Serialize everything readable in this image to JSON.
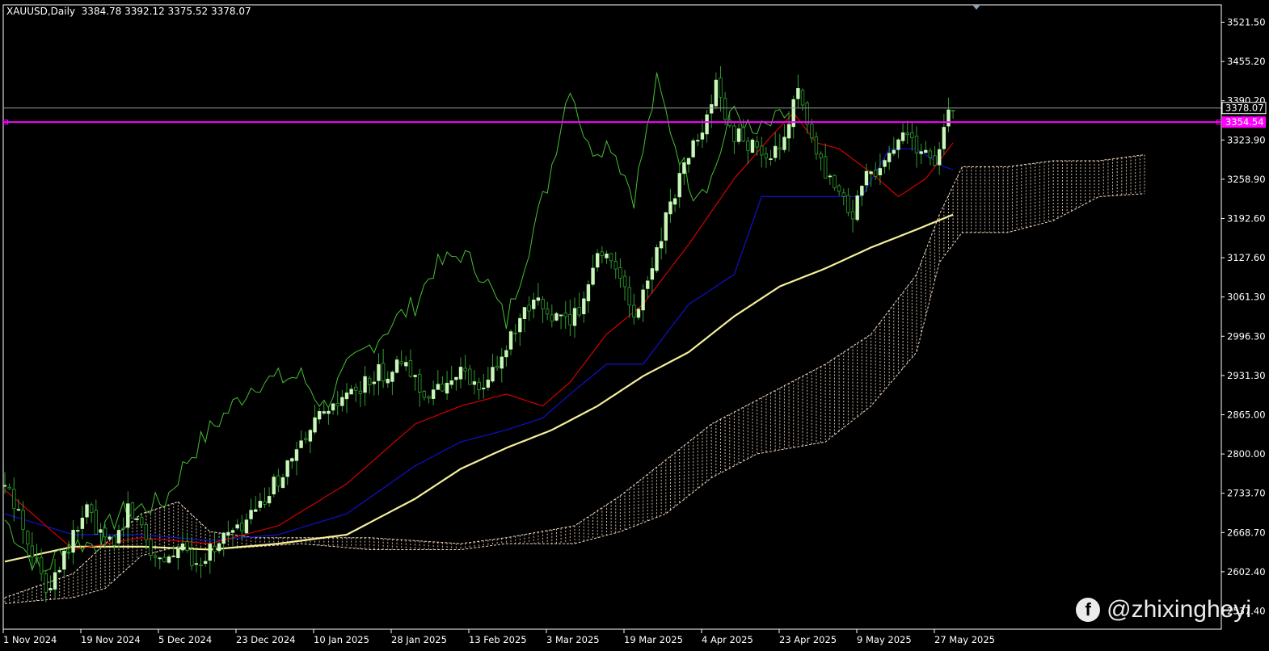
{
  "header": {
    "symbol": "XAUUSD,Daily",
    "ohlc": "3384.78 3392.12 3375.52 3378.07"
  },
  "watermark": {
    "text": "@zhixingheyi",
    "icon": "facebook-icon"
  },
  "colors": {
    "background": "#000000",
    "frame": "#ffffff",
    "candle_up": "#c8f7b8",
    "candle_down": "#000000",
    "candle_wick": "#2e9e2e",
    "chikou": "#44c032",
    "tenkan": "#d40000",
    "kijun": "#1010d0",
    "ma": "#f4ef9a",
    "cloud": "#f3d9c0",
    "hline": "#ff00ff",
    "price_line": "#9a9a9a"
  },
  "chart_data": {
    "type": "candlestick",
    "title": "XAUUSD,Daily",
    "ylim": [
      2540,
      3545
    ],
    "y_ticks": [
      "3521.50",
      "3455.20",
      "3390.20",
      "3323.90",
      "3258.90",
      "3192.60",
      "3127.60",
      "3061.30",
      "2996.30",
      "2931.30",
      "2865.00",
      "2800.00",
      "2733.70",
      "2668.70",
      "2602.40",
      "2537.40"
    ],
    "x_ticks": [
      "1 Nov 2024",
      "19 Nov 2024",
      "5 Dec 2024",
      "23 Dec 2024",
      "10 Jan 2025",
      "28 Jan 2025",
      "13 Feb 2025",
      "3 Mar 2025",
      "19 Mar 2025",
      "4 Apr 2025",
      "23 Apr 2025",
      "9 May 2025",
      "27 May 2025"
    ],
    "current_price": {
      "label": "3378.07",
      "value": 3378.07
    },
    "horizontal_line": {
      "label": "3354.54",
      "value": 3354.54
    },
    "candle_anchors": [
      [
        0,
        2745
      ],
      [
        3,
        2700
      ],
      [
        6,
        2640
      ],
      [
        9,
        2575
      ],
      [
        12,
        2620
      ],
      [
        15,
        2660
      ],
      [
        18,
        2710
      ],
      [
        21,
        2660
      ],
      [
        24,
        2650
      ],
      [
        27,
        2710
      ],
      [
        30,
        2680
      ],
      [
        33,
        2625
      ],
      [
        36,
        2630
      ],
      [
        39,
        2640
      ],
      [
        42,
        2620
      ],
      [
        45,
        2640
      ],
      [
        48,
        2660
      ],
      [
        51,
        2670
      ],
      [
        54,
        2695
      ],
      [
        57,
        2720
      ],
      [
        60,
        2760
      ],
      [
        63,
        2790
      ],
      [
        66,
        2820
      ],
      [
        69,
        2860
      ],
      [
        72,
        2870
      ],
      [
        75,
        2900
      ],
      [
        78,
        2905
      ],
      [
        81,
        2935
      ],
      [
        84,
        2935
      ],
      [
        87,
        2950
      ],
      [
        90,
        2925
      ],
      [
        93,
        2895
      ],
      [
        96,
        2910
      ],
      [
        99,
        2940
      ],
      [
        102,
        2920
      ],
      [
        105,
        2900
      ],
      [
        108,
        2955
      ],
      [
        111,
        2990
      ],
      [
        114,
        3030
      ],
      [
        117,
        3050
      ],
      [
        120,
        3030
      ],
      [
        123,
        3020
      ],
      [
        126,
        3040
      ],
      [
        129,
        3120
      ],
      [
        132,
        3140
      ],
      [
        135,
        3100
      ],
      [
        138,
        3020
      ],
      [
        141,
        3090
      ],
      [
        144,
        3170
      ],
      [
        147,
        3240
      ],
      [
        150,
        3300
      ],
      [
        153,
        3340
      ],
      [
        156,
        3410
      ],
      [
        159,
        3340
      ],
      [
        162,
        3325
      ],
      [
        165,
        3310
      ],
      [
        168,
        3280
      ],
      [
        171,
        3340
      ],
      [
        174,
        3400
      ],
      [
        177,
        3320
      ],
      [
        180,
        3260
      ],
      [
        183,
        3230
      ],
      [
        186,
        3200
      ],
      [
        189,
        3270
      ],
      [
        192,
        3280
      ],
      [
        195,
        3310
      ],
      [
        198,
        3340
      ],
      [
        201,
        3300
      ],
      [
        204,
        3290
      ],
      [
        207,
        3370
      ],
      [
        208,
        3378
      ]
    ],
    "chikou_anchors": [
      [
        0,
        2690
      ],
      [
        8,
        2600
      ],
      [
        14,
        2650
      ],
      [
        20,
        2650
      ],
      [
        25,
        2700
      ],
      [
        30,
        2710
      ],
      [
        35,
        2720
      ],
      [
        40,
        2790
      ],
      [
        45,
        2840
      ],
      [
        50,
        2880
      ],
      [
        55,
        2920
      ],
      [
        60,
        2925
      ],
      [
        65,
        2930
      ],
      [
        70,
        2880
      ],
      [
        75,
        2940
      ],
      [
        80,
        2980
      ],
      [
        85,
        3020
      ],
      [
        90,
        3050
      ],
      [
        94,
        3110
      ],
      [
        100,
        3135
      ],
      [
        105,
        3100
      ],
      [
        110,
        3020
      ],
      [
        115,
        3150
      ],
      [
        119,
        3250
      ],
      [
        124,
        3420
      ],
      [
        128,
        3310
      ],
      [
        133,
        3320
      ],
      [
        138,
        3230
      ],
      [
        143,
        3420
      ],
      [
        147,
        3320
      ],
      [
        151,
        3240
      ],
      [
        155,
        3260
      ],
      [
        160,
        3380
      ],
      [
        164,
        3330
      ],
      [
        168,
        3350
      ],
      [
        172,
        3370
      ]
    ],
    "tenkan_anchors": [
      [
        0,
        2740
      ],
      [
        15,
        2640
      ],
      [
        30,
        2660
      ],
      [
        45,
        2650
      ],
      [
        60,
        2680
      ],
      [
        75,
        2750
      ],
      [
        90,
        2850
      ],
      [
        100,
        2880
      ],
      [
        110,
        2900
      ],
      [
        118,
        2880
      ],
      [
        124,
        2920
      ],
      [
        132,
        3000
      ],
      [
        140,
        3050
      ],
      [
        150,
        3150
      ],
      [
        160,
        3260
      ],
      [
        168,
        3330
      ],
      [
        173,
        3370
      ],
      [
        178,
        3320
      ],
      [
        183,
        3310
      ],
      [
        190,
        3270
      ],
      [
        196,
        3230
      ],
      [
        202,
        3260
      ],
      [
        208,
        3320
      ]
    ],
    "kijun_anchors": [
      [
        0,
        2700
      ],
      [
        15,
        2665
      ],
      [
        30,
        2665
      ],
      [
        45,
        2655
      ],
      [
        60,
        2665
      ],
      [
        75,
        2700
      ],
      [
        90,
        2780
      ],
      [
        100,
        2820
      ],
      [
        110,
        2840
      ],
      [
        118,
        2860
      ],
      [
        124,
        2900
      ],
      [
        132,
        2950
      ],
      [
        140,
        2950
      ],
      [
        150,
        3050
      ],
      [
        160,
        3100
      ],
      [
        166,
        3230
      ],
      [
        175,
        3230
      ],
      [
        188,
        3230
      ],
      [
        194,
        3310
      ],
      [
        200,
        3310
      ],
      [
        206,
        3280
      ],
      [
        208,
        3275
      ]
    ],
    "ma_anchors": [
      [
        0,
        2620
      ],
      [
        15,
        2645
      ],
      [
        30,
        2645
      ],
      [
        45,
        2640
      ],
      [
        60,
        2650
      ],
      [
        75,
        2665
      ],
      [
        90,
        2725
      ],
      [
        100,
        2775
      ],
      [
        110,
        2810
      ],
      [
        120,
        2840
      ],
      [
        130,
        2880
      ],
      [
        140,
        2930
      ],
      [
        150,
        2970
      ],
      [
        160,
        3030
      ],
      [
        170,
        3080
      ],
      [
        180,
        3110
      ],
      [
        190,
        3145
      ],
      [
        200,
        3175
      ],
      [
        208,
        3200
      ]
    ],
    "cloud_a_anchors": [
      [
        0,
        2560
      ],
      [
        15,
        2600
      ],
      [
        22,
        2650
      ],
      [
        30,
        2700
      ],
      [
        38,
        2720
      ],
      [
        45,
        2670
      ],
      [
        55,
        2660
      ],
      [
        65,
        2660
      ],
      [
        80,
        2660
      ],
      [
        100,
        2650
      ],
      [
        110,
        2660
      ],
      [
        125,
        2680
      ],
      [
        135,
        2730
      ],
      [
        145,
        2790
      ],
      [
        155,
        2850
      ],
      [
        165,
        2890
      ],
      [
        180,
        2950
      ],
      [
        190,
        3000
      ],
      [
        200,
        3100
      ],
      [
        205,
        3200
      ],
      [
        210,
        3280
      ],
      [
        220,
        3280
      ],
      [
        230,
        3290
      ],
      [
        240,
        3290
      ],
      [
        250,
        3300
      ]
    ],
    "cloud_b_anchors": [
      [
        0,
        2550
      ],
      [
        15,
        2560
      ],
      [
        22,
        2575
      ],
      [
        30,
        2630
      ],
      [
        38,
        2645
      ],
      [
        45,
        2640
      ],
      [
        55,
        2645
      ],
      [
        65,
        2650
      ],
      [
        80,
        2640
      ],
      [
        100,
        2640
      ],
      [
        110,
        2650
      ],
      [
        125,
        2650
      ],
      [
        135,
        2670
      ],
      [
        145,
        2700
      ],
      [
        155,
        2760
      ],
      [
        165,
        2800
      ],
      [
        180,
        2820
      ],
      [
        190,
        2880
      ],
      [
        200,
        2970
      ],
      [
        205,
        3120
      ],
      [
        210,
        3170
      ],
      [
        220,
        3170
      ],
      [
        230,
        3190
      ],
      [
        240,
        3230
      ],
      [
        250,
        3235
      ]
    ]
  }
}
